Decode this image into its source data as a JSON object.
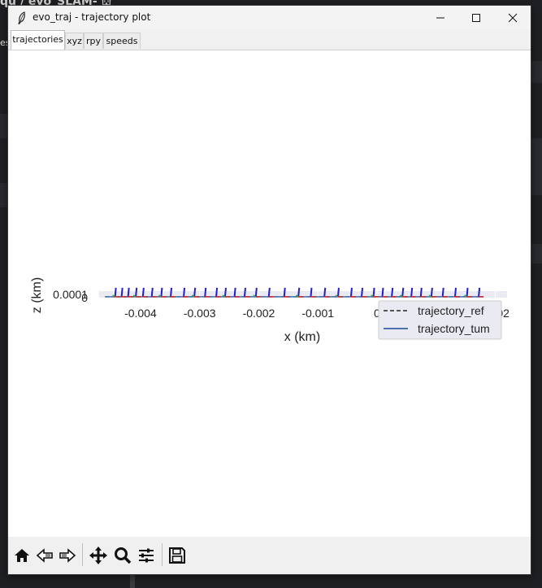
{
  "background_app": {
    "title_fragment": "qu  /  evo_SLAM- ⛫",
    "side_fragment": "es"
  },
  "window": {
    "title": "evo_traj - trajectory plot",
    "controls": {
      "minimize": "minimize-icon",
      "maximize": "maximize-icon",
      "close": "close-icon"
    }
  },
  "tabs": [
    {
      "label": "trajectories",
      "active": true
    },
    {
      "label": "xyz",
      "active": false
    },
    {
      "label": "rpy",
      "active": false
    },
    {
      "label": "speeds",
      "active": false
    }
  ],
  "toolbar": {
    "items": [
      "home-icon",
      "back-icon",
      "forward-icon",
      "pan-icon",
      "zoom-icon",
      "configure-subplots-icon",
      "save-icon"
    ]
  },
  "chart_data": {
    "type": "line",
    "xlabel": "x (km)",
    "ylabel": "z (km)",
    "x_ticks": [
      "-0.004",
      "-0.003",
      "-0.002",
      "-0.001",
      "0",
      "0.002"
    ],
    "x_tick_values": [
      -0.004,
      -0.003,
      -0.002,
      -0.001,
      0,
      0.002
    ],
    "y_ticks": [
      "0.0001",
      "0"
    ],
    "y_tick_values": [
      0.0001,
      0
    ],
    "xlim": [
      -0.0047,
      0.0022
    ],
    "ylim": [
      -2e-05,
      0.00012
    ],
    "grid": true,
    "legend_position": "bottom-right",
    "series": [
      {
        "name": "trajectory_ref",
        "style": "dashed",
        "color": "#555555",
        "x": [
          -0.0046,
          -0.004,
          -0.0034,
          -0.0028,
          -0.0022,
          -0.0016,
          -0.001,
          -0.0004,
          0.0002,
          0.0008,
          0.0014,
          0.0018
        ],
        "y": [
          0,
          0,
          0,
          0,
          0,
          0,
          0,
          0,
          0,
          0,
          0,
          0
        ]
      },
      {
        "name": "trajectory_tum",
        "style": "solid",
        "color": "#4c72b0",
        "x": [
          -0.0046,
          -0.004,
          -0.0034,
          -0.0028,
          -0.0022,
          -0.0016,
          -0.001,
          -0.0004,
          0.0002,
          0.0008,
          0.0014,
          0.0018
        ],
        "y": [
          0,
          0,
          0,
          0,
          0,
          0,
          0,
          0,
          0,
          0,
          0,
          0
        ]
      }
    ],
    "orientation_markers": {
      "x": [
        -0.00443,
        -0.00432,
        -0.00421,
        -0.00408,
        -0.00396,
        -0.00381,
        -0.00365,
        -0.00349,
        -0.00327,
        -0.00309,
        -0.00291,
        -0.00272,
        -0.00257,
        -0.00241,
        -0.00224,
        -0.00205,
        -0.00183,
        -0.00157,
        -0.00133,
        -0.00112,
        -0.00089,
        -0.00066,
        -0.00044,
        -0.00026,
        -6e-05,
        9e-05,
        0.00025,
        0.00043,
        0.00058,
        0.00074,
        0.00092,
        0.00111,
        0.00132,
        0.00152,
        0.00172
      ],
      "colors": {
        "x_axis": "#d62728",
        "y_axis": "#2ca02c",
        "z_axis": "#1f1fcf"
      }
    }
  }
}
